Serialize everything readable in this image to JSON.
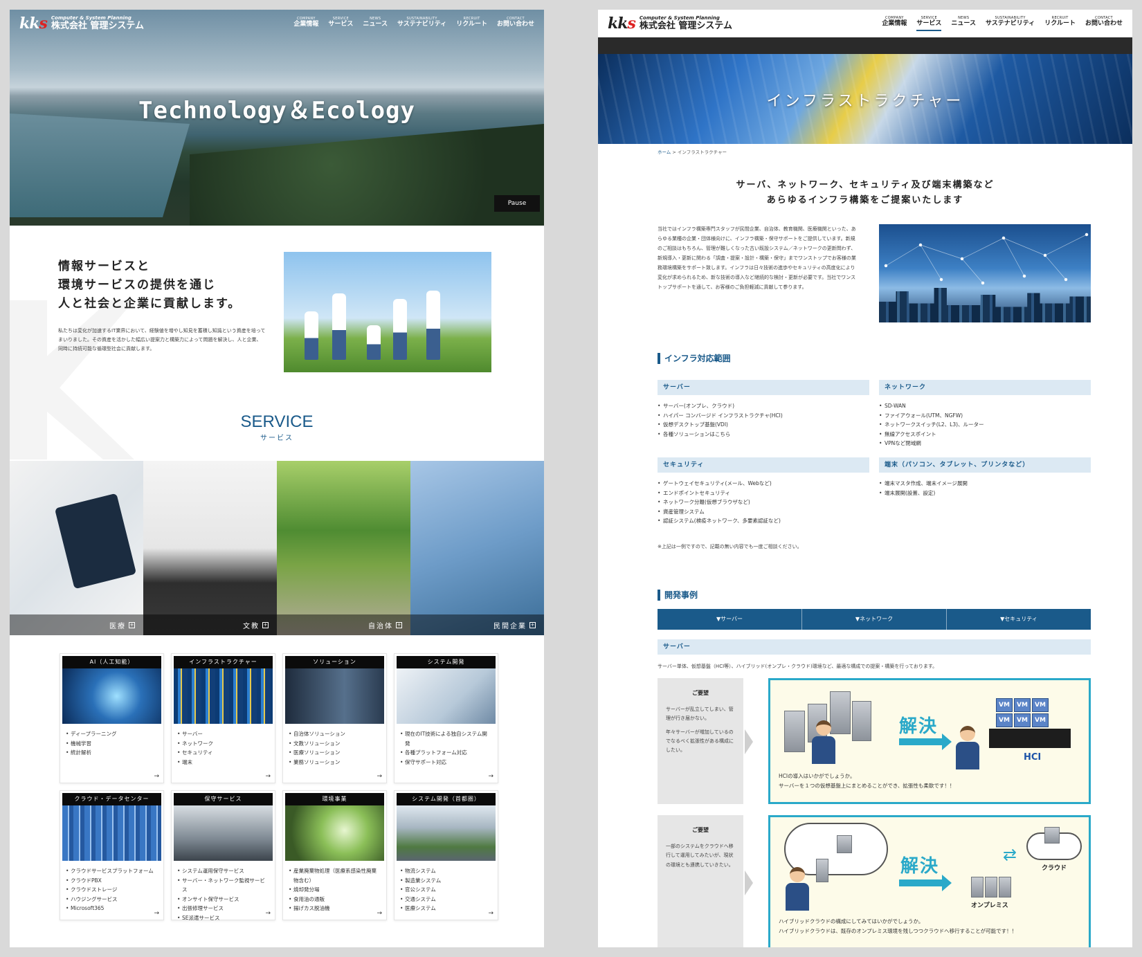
{
  "header": {
    "logo_mark_black": "kk",
    "logo_mark_red": "s",
    "logo_sub": "Computer & System Planning",
    "logo_main": "株式会社 管理システム",
    "nav": [
      {
        "en": "COMPANY",
        "jp": "企業情報"
      },
      {
        "en": "SERVICE",
        "jp": "サービス"
      },
      {
        "en": "NEWS",
        "jp": "ニュース"
      },
      {
        "en": "SUSTAINABILITY",
        "jp": "サステナビリティ"
      },
      {
        "en": "RECRUIT",
        "jp": "リクルート"
      },
      {
        "en": "CONTACT",
        "jp": "お問い合わせ"
      }
    ]
  },
  "home": {
    "hero_title": "Technology＆Ecology",
    "pause_label": "Pause",
    "mission_heading": [
      "情報サービスと",
      "環境サービスの提供を通じ",
      "人と社会と企業に貢献します。"
    ],
    "mission_text": "私たちは変化が加速するIT業界において、経験値を増やし知見を蓄積し知識という資産を培ってまいりました。その資産を活かした幅広い提案力と構築力によって問題を解決し、人と企業、同時に持続可能な循環型社会に貢献します。",
    "service_en": "SERVICE",
    "service_jp": "サービス",
    "sectors": [
      "医療",
      "文教",
      "自治体",
      "民間企業"
    ],
    "cards": [
      {
        "title": "AI（人工知能）",
        "items": [
          "ディープラーニング",
          "機械学習",
          "統計解析"
        ]
      },
      {
        "title": "インフラストラクチャー",
        "items": [
          "サーバー",
          "ネットワーク",
          "セキュリティ",
          "端末"
        ]
      },
      {
        "title": "ソリューション",
        "items": [
          "自治体ソリューション",
          "文教ソリューション",
          "医療ソリューション",
          "業務ソリューション"
        ]
      },
      {
        "title": "システム開発",
        "items": [
          "現在のIT技術による独自システム開発",
          "各種プラットフォーム対応",
          "保守サポート対応"
        ]
      },
      {
        "title": "クラウド・データセンター",
        "items": [
          "クラウドサービスプラットフォーム",
          "クラウドPBX",
          "クラウドストレージ",
          "ハウジングサービス",
          "Microsoft365"
        ]
      },
      {
        "title": "保守サービス",
        "items": [
          "システム運用保守サービス",
          "サーバー・ネットワーク監視サービス",
          "オンサイト保守サービス",
          "出張修理サービス",
          "SE派遣サービス"
        ]
      },
      {
        "title": "環境事業",
        "items": [
          "産業廃棄物処理（医療系感染性廃棄物含む）",
          "焼却発分場",
          "食用油の通販",
          "揚げカス脱油機"
        ]
      },
      {
        "title": "システム開発（首都圏）",
        "items": [
          "物流システム",
          "製造業システム",
          "官公システム",
          "交通システム",
          "医療システム"
        ]
      }
    ],
    "card_arrow": "→"
  },
  "infra": {
    "banner_title": "インフラストラクチャー",
    "breadcrumb_home": "ホーム",
    "breadcrumb_sep": " > ",
    "breadcrumb_current": "インフラストラクチャー",
    "lead": [
      "サーバ、ネットワーク、セキュリティ及び端末構築など",
      "あらゆるインフラ構築をご提案いたします"
    ],
    "intro": "当社ではインフラ構築専門スタッフが民間企業、自治体、教育機関、医療機関といった、あらゆる業種の企業・団体様向けに、インフラ構築・保守サポートをご提供しています。新規のご相談はもちろん、管理が難しくなった古い既設システム／ネットワークの更新問わず、新規導入・更新に関わる「調査・提案・設計・構築・保守」までワンストップでお客様の業務環境構築をサポート致します。インフラは日々技術の進歩やセキュリティの高度化により変化が求められるため、新な技術の導入など継続的な検討・更新が必要です。当社でワンストップサポートを通して、お客様のご負担軽減に貢献して参ります。",
    "scope_heading": "インフラ対応範囲",
    "scope": [
      {
        "title": "サーバー",
        "items": [
          "サーバー(オンプレ、クラウド)",
          "ハイパー コンバージド インフラストラクチャ(HCI)",
          "仮想デスクトップ基盤(VDI)",
          "各種ソリューションはこちら"
        ]
      },
      {
        "title": "ネットワーク",
        "items": [
          "SD-WAN",
          "ファイアウォール(UTM、NGFW)",
          "ネットワークスイッチ(L2、L3)、ルーター",
          "無線アクセスポイント",
          "VPNなど閉域網"
        ]
      },
      {
        "title": "セキュリティ",
        "items": [
          "ゲートウェイセキュリティ(メール、Webなど)",
          "エンドポイントセキュリティ",
          "ネットワーク分離(仮想ブラウザなど)",
          "資産管理システム",
          "認証システム(検疫ネットワーク、多要素認証など)"
        ]
      },
      {
        "title": "端末（パソコン、タブレット、プリンタなど）",
        "items": [
          "端末マスタ作成、端末イメージ展開",
          "端末展開(設置、設定)"
        ]
      }
    ],
    "scope_note": "※上記は一例ですので、記載の無い内容でも一度ご相談ください。",
    "cases_heading": "開発事例",
    "tabs": [
      "▼サーバー",
      "▼ネットワーク",
      "▼セキュリティ"
    ],
    "case_band": "サーバー",
    "case_desc": "サーバー単体、仮想基盤（HCI等）、ハイブリッド(オンプレ・クラウド)環境など、最適な構成での提案・構築を行っております。",
    "requests": [
      {
        "heading": "ご要望",
        "text": [
          "サーバーが乱立してしまい、管理が行き届かない。",
          "年々サーバーが増加しているのでなるべく拡張性がある構成にしたい。"
        ]
      },
      {
        "heading": "ご要望",
        "text": [
          "一部のシステムをクラウドへ移行して運用してみたいが、現状の環境とも連携していきたい。"
        ]
      }
    ],
    "solutions": [
      {
        "resolve": "解決",
        "vm": "VM",
        "hci": "HCI",
        "caption": [
          "HCIの導入はいかがでしょうか。",
          "サーバーを１つの仮想基盤上にまとめることができ、拡張性も柔軟です！！"
        ]
      },
      {
        "resolve": "解決",
        "cloud": "クラウド",
        "onprem": "オンプレミス",
        "caption": [
          "ハイブリッドクラウドの構成にしてみてはいかがでしょうか。",
          "ハイブリッドクラウドは、既存のオンプレミス環境を残しつつクラウドへ移行することが可能です！！"
        ]
      }
    ]
  }
}
